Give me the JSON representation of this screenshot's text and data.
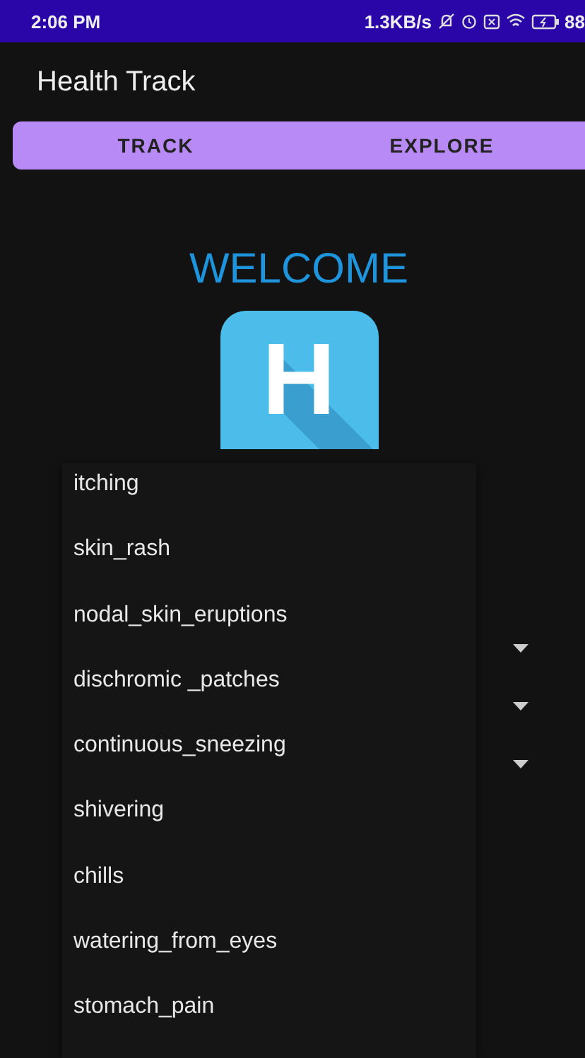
{
  "status_bar": {
    "time": "2:06 PM",
    "speed": "1.3KB/s",
    "battery": "88"
  },
  "app_bar": {
    "title": "Health Track"
  },
  "tabs": [
    {
      "label": "TRACK"
    },
    {
      "label": "EXPLORE"
    }
  ],
  "welcome": "WELCOME",
  "logo": {
    "letter": "H"
  },
  "dropdown": {
    "options": [
      "itching",
      "skin_rash",
      "nodal_skin_eruptions",
      "dischromic _patches",
      "continuous_sneezing",
      "shivering",
      "chills",
      "watering_from_eyes",
      "stomach_pain"
    ]
  },
  "spinners": [
    {
      "kind": "spinner"
    },
    {
      "kind": "spinner"
    },
    {
      "kind": "spinner"
    }
  ]
}
